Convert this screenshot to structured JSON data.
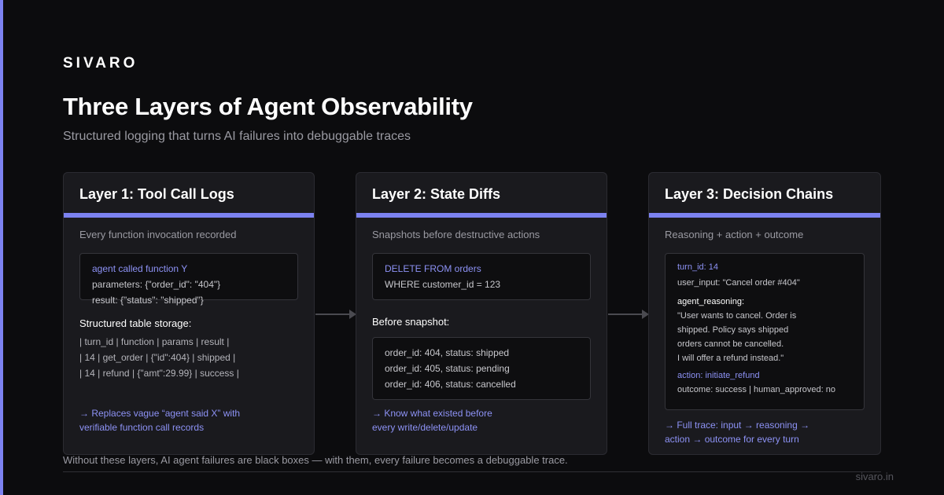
{
  "brand": "SIVARO",
  "title": "Three Layers of Agent Observability",
  "subtitle": "Structured logging that turns AI failures into debuggable traces",
  "colors": {
    "accent": "#7c82f0",
    "background": "#0c0c0e",
    "card": "#1a1a1e"
  },
  "layer1": {
    "title": "Layer 1: Tool Call Logs",
    "desc": "Every function invocation recorded",
    "code": [
      "agent called function Y",
      "parameters: {\"order_id\": \"404\"}",
      "result: {\"status\": \"shipped\"}"
    ],
    "table_label": "Structured table storage:",
    "table": [
      "| turn_id | function | params | result |",
      "| 14 | get_order | {\"id\":404} | shipped |",
      "| 14 | refund | {\"amt\":29.99} | success |"
    ],
    "takeaway": [
      "→ Replaces vague “agent said X” with",
      "verifiable function call records"
    ]
  },
  "layer2": {
    "title": "Layer 2: State Diffs",
    "desc": "Snapshots before destructive actions",
    "code": [
      "DELETE FROM orders",
      "WHERE customer_id = 123"
    ],
    "snapshot_label": "Before snapshot:",
    "snapshot": [
      "order_id: 404, status: shipped",
      "order_id: 405, status: pending",
      "order_id: 406, status: cancelled"
    ],
    "takeaway": [
      "→ Know what existed before",
      "every write/delete/update"
    ]
  },
  "layer3": {
    "title": "Layer 3: Decision Chains",
    "desc": "Reasoning + action + outcome",
    "turn_id": "turn_id: 14",
    "user_input": "user_input: \"Cancel order #404\"",
    "reasoning_label": "agent_reasoning:",
    "reasoning": [
      "\"User wants to cancel. Order is",
      "shipped. Policy says shipped",
      "orders cannot be cancelled.",
      "I will offer a refund instead.\""
    ],
    "action": "action: initiate_refund",
    "outcome": "outcome: success | human_approved: no",
    "takeaway": [
      "→ Full trace: input → reasoning →",
      "action → outcome for every turn"
    ]
  },
  "footer": {
    "note": "Without these layers, AI agent failures are black boxes — with them, every failure becomes a debuggable trace.",
    "url": "sivaro.in"
  }
}
